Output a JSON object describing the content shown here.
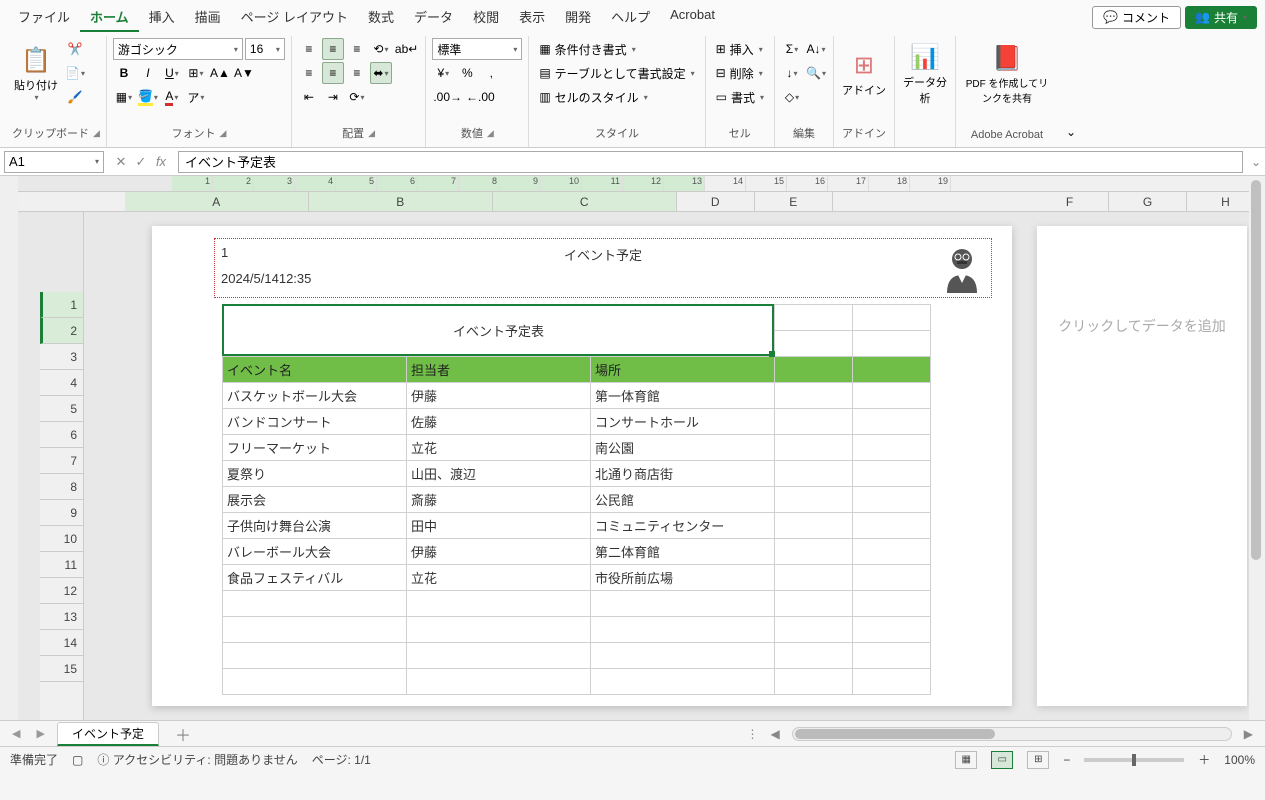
{
  "menu": {
    "tabs": [
      "ファイル",
      "ホーム",
      "挿入",
      "描画",
      "ページ レイアウト",
      "数式",
      "データ",
      "校閲",
      "表示",
      "開発",
      "ヘルプ",
      "Acrobat"
    ],
    "active_index": 1,
    "comment": "コメント",
    "share": "共有"
  },
  "ribbon": {
    "clipboard": {
      "paste": "貼り付け",
      "label": "クリップボード"
    },
    "font": {
      "name": "游ゴシック",
      "size": "16",
      "label": "フォント"
    },
    "alignment": {
      "label": "配置"
    },
    "number": {
      "format": "標準",
      "label": "数値"
    },
    "styles": {
      "conditional": "条件付き書式",
      "table": "テーブルとして書式設定",
      "cell": "セルのスタイル",
      "label": "スタイル"
    },
    "cells": {
      "insert": "挿入",
      "delete": "削除",
      "format": "書式",
      "label": "セル"
    },
    "editing": {
      "label": "編集"
    },
    "addin": {
      "btn": "アドイン",
      "label": "アドイン"
    },
    "analysis": {
      "btn": "データ分析",
      "label": ""
    },
    "acrobat": {
      "btn": "PDF を作成してリンクを共有",
      "label": "Adobe Acrobat"
    }
  },
  "fx": {
    "namebox": "A1",
    "formula": "イベント予定表"
  },
  "ruler": {
    "ticks": [
      "1",
      "2",
      "3",
      "4",
      "5",
      "6",
      "7",
      "8",
      "9",
      "10",
      "11",
      "12",
      "13",
      "14",
      "15",
      "16",
      "17",
      "18",
      "19"
    ]
  },
  "columns": [
    "A",
    "B",
    "C",
    "D",
    "E"
  ],
  "columns_right": [
    "F",
    "G",
    "H"
  ],
  "row_count": 15,
  "page_header": {
    "left_num": "1",
    "center": "イベント予定",
    "datetime": "2024/5/1412:35"
  },
  "title": "イベント予定表",
  "table": {
    "headers": [
      "イベント名",
      "担当者",
      "場所"
    ],
    "rows": [
      [
        "バスケットボール大会",
        "伊藤",
        "第一体育館"
      ],
      [
        "バンドコンサート",
        "佐藤",
        "コンサートホール"
      ],
      [
        "フリーマーケット",
        "立花",
        "南公園"
      ],
      [
        "夏祭り",
        "山田、渡辺",
        "北通り商店街"
      ],
      [
        "展示会",
        "斎藤",
        "公民館"
      ],
      [
        "子供向け舞台公演",
        "田中",
        "コミュニティセンター"
      ],
      [
        "バレーボール大会",
        "伊藤",
        "第二体育館"
      ],
      [
        "食品フェスティバル",
        "立花",
        "市役所前広場"
      ]
    ]
  },
  "side_hint": "クリックしてデータを追加",
  "sheet_tab": "イベント予定",
  "status": {
    "ready": "準備完了",
    "accessibility": "アクセシビリティ: 問題ありません",
    "page": "ページ: 1/1",
    "zoom": "100%"
  }
}
